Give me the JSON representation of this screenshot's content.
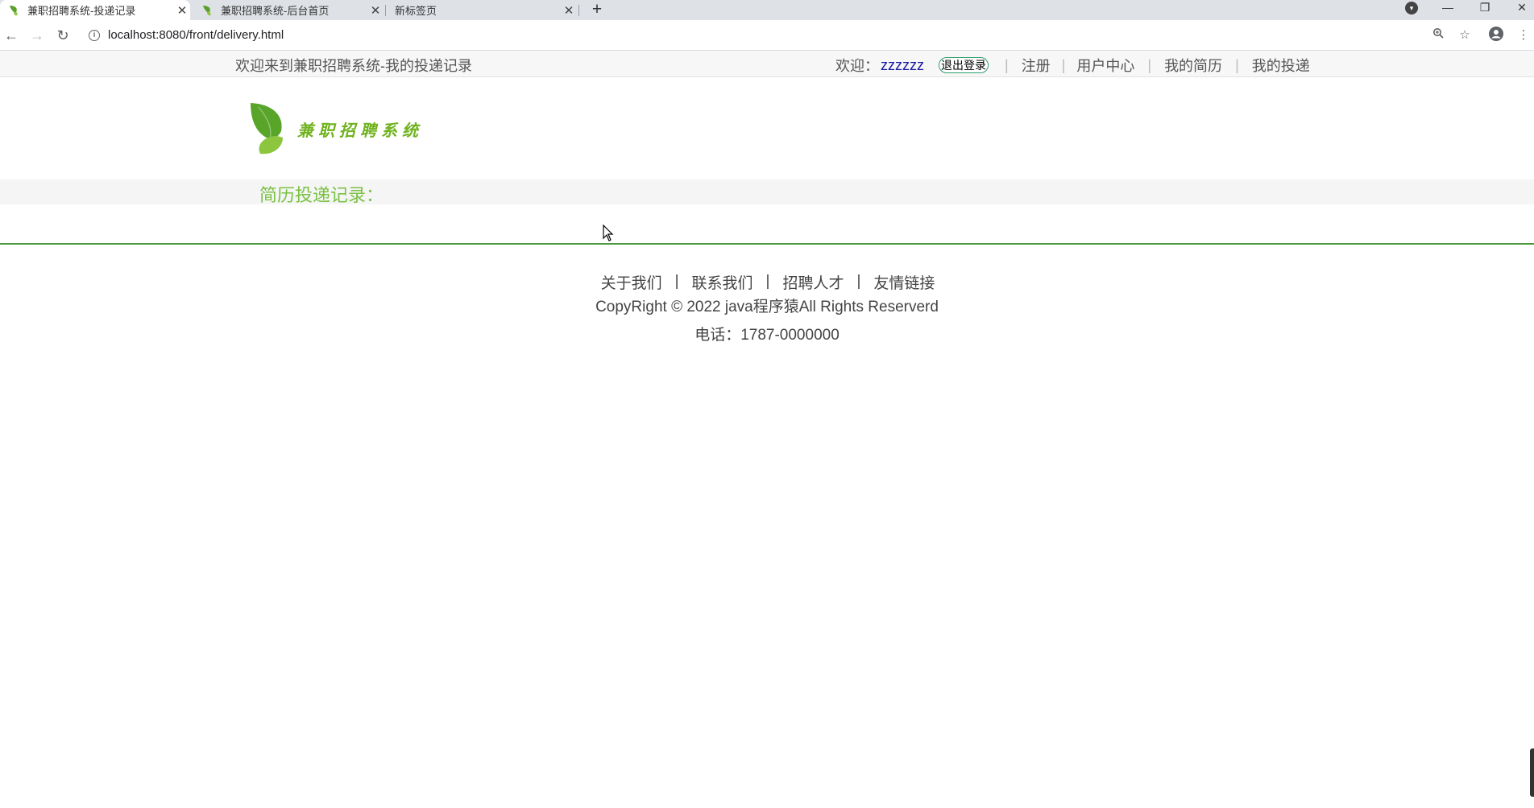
{
  "browser": {
    "tabs": [
      {
        "title": "兼职招聘系统-投递记录",
        "active": true
      },
      {
        "title": "兼职招聘系统-后台首页",
        "active": false
      },
      {
        "title": "新标签页",
        "active": false
      }
    ],
    "new_tab": "+",
    "url": "localhost:8080/front/delivery.html",
    "window_controls": {
      "minimize": "—",
      "restore": "❐",
      "close": "✕"
    }
  },
  "header": {
    "site_title": "欢迎来到兼职招聘系统-我的投递记录",
    "welcome_label": "欢迎：",
    "username": "zzzzzz",
    "logout_label": "退出登录",
    "nav": [
      "注册",
      "用户中心",
      "我的简历",
      "我的投递"
    ]
  },
  "logo": {
    "brand_text": "兼职招聘系统",
    "accent": "#6fb21d"
  },
  "section": {
    "title": "简历投递记录："
  },
  "footer": {
    "links": [
      "关于我们",
      "联系我们",
      "招聘人才",
      "友情链接"
    ],
    "copyright": "CopyRight © 2022 java程序猿All Rights Reserverd",
    "phone": "电话：1787-0000000"
  },
  "colors": {
    "accent_green": "#7ac143",
    "divider_green": "#4a9a3b",
    "user_blue": "#1a1aa6"
  }
}
